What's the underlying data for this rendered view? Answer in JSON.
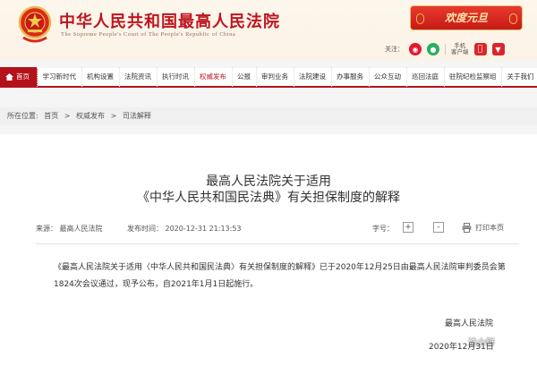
{
  "header": {
    "site_title": "中华人民共和国最高人民法院",
    "site_subtitle": "The Supreme People's Court of The People's Republic of China",
    "banner_text": "欢度元旦",
    "follow_label": "关注：",
    "mobile_label_line1": "手机",
    "mobile_label_line2": "客户端"
  },
  "nav": {
    "items": [
      {
        "label": "首页"
      },
      {
        "label": "学习新时代"
      },
      {
        "label": "机构设置"
      },
      {
        "label": "法院资讯"
      },
      {
        "label": "执行时讯"
      },
      {
        "label": "权威发布"
      },
      {
        "label": "公报"
      },
      {
        "label": "审判业务"
      },
      {
        "label": "法院建设"
      },
      {
        "label": "办事服务"
      },
      {
        "label": "公众互动"
      },
      {
        "label": "巡回法庭"
      },
      {
        "label": "驻院纪检监察组"
      },
      {
        "label": "关于我们"
      }
    ]
  },
  "breadcrumb": {
    "prefix": "所在位置:",
    "items": [
      "首页",
      "权威发布",
      "司法解释"
    ],
    "separator": ">"
  },
  "article": {
    "title_line1": "最高人民法院关于适用",
    "title_line2": "《中华人民共和国民法典》有关担保制度的解释",
    "source": "来源：  最高人民法院",
    "publish_time": "发布时间：  2020-12-31 21:13:53",
    "font_size_label": "字号：",
    "font_plus": "+",
    "font_minus": "-",
    "print_label": "打印本页",
    "paragraph": "《最高人民法院关于适用〈中华人民共和国民法典〉有关担保制度的解释》已于2020年12月25日由最高人民法院审判委员会第1824次会议通过，现予公布，自2021年1月1日起施行。",
    "sign_org": "最高人民法院",
    "sign_date": "2020年12月31日"
  },
  "watermark": {
    "text": "法小鲜"
  },
  "colors": {
    "brand_red": "#b3121b",
    "title_red": "#c0141e"
  }
}
